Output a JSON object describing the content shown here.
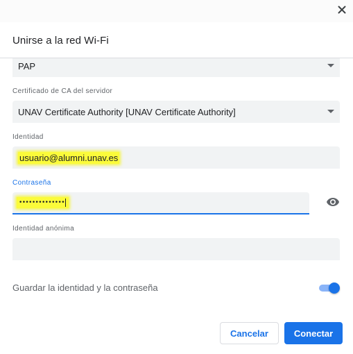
{
  "dialog": {
    "title": "Unirse a la red Wi-Fi"
  },
  "eap_method": {
    "value": "PAP"
  },
  "ca_certificate": {
    "label": "Certificado de CA del servidor",
    "value": "UNAV Certificate Authority [UNAV Certificate Authority]"
  },
  "identity": {
    "label": "Identidad",
    "value": "usuario@alumni.unav.es"
  },
  "password": {
    "label": "Contraseña",
    "value": "••••••••••••••"
  },
  "anonymous_identity": {
    "label": "Identidad anónima",
    "value": ""
  },
  "save_credentials": {
    "label": "Guardar la identidad y la contraseña",
    "enabled": true
  },
  "buttons": {
    "cancel": "Cancelar",
    "connect": "Conectar"
  },
  "colors": {
    "accent": "#1a73e8",
    "highlight": "#fbfb3a"
  }
}
